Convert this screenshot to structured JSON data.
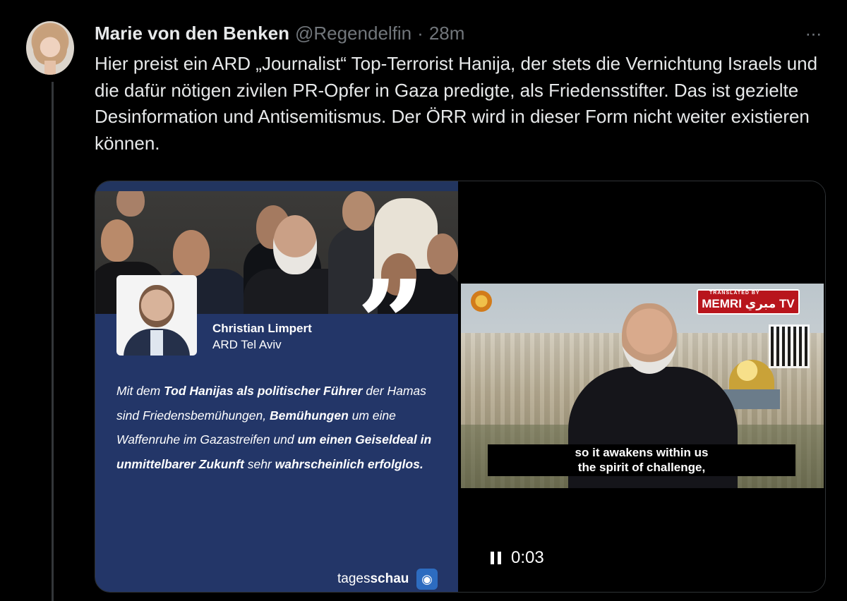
{
  "tweet": {
    "author_name": "Marie von den Benken",
    "handle": "@Regendelfin",
    "separator": "·",
    "time": "28m",
    "more_label": "···",
    "text": "Hier preist ein ARD „Journalist“ Top-Terrorist Hanija, der stets die Vernichtung Israels und die dafür nötigen zivilen PR-Opfer in Gaza predigte, als Friedensstifter. Das ist gezielte Desinformation und Antisemitismus. Der ÖRR wird in dieser Form nicht weiter existieren können."
  },
  "left_image": {
    "reporter_name": "Christian Limpert",
    "reporter_org": "ARD Tel Aviv",
    "quote_mark": "”",
    "quote_parts": [
      {
        "t": "Mit dem ",
        "b": false
      },
      {
        "t": "Tod Hanijas als politischer Führer",
        "b": true
      },
      {
        "t": " der Hamas sind Friedensbemühungen, ",
        "b": false
      },
      {
        "t": "Bemühungen",
        "b": true
      },
      {
        "t": " um eine Waffenruhe im Gazastreifen und ",
        "b": false
      },
      {
        "t": "um einen Geiseldeal in unmittelbarer Zukunft",
        "b": true
      },
      {
        "t": " sehr ",
        "b": false
      },
      {
        "t": "wahrscheinlich erfolglos.",
        "b": true
      }
    ],
    "logo_regular": "tages",
    "logo_bold": "schau"
  },
  "video": {
    "memri_small": "TRANSLATED BY",
    "memri_label": "MEMRI مبري TV",
    "subtitle_line1": "so it awakens within us",
    "subtitle_line2": "the spirit of challenge,",
    "time": "0:03",
    "state": "playing"
  }
}
